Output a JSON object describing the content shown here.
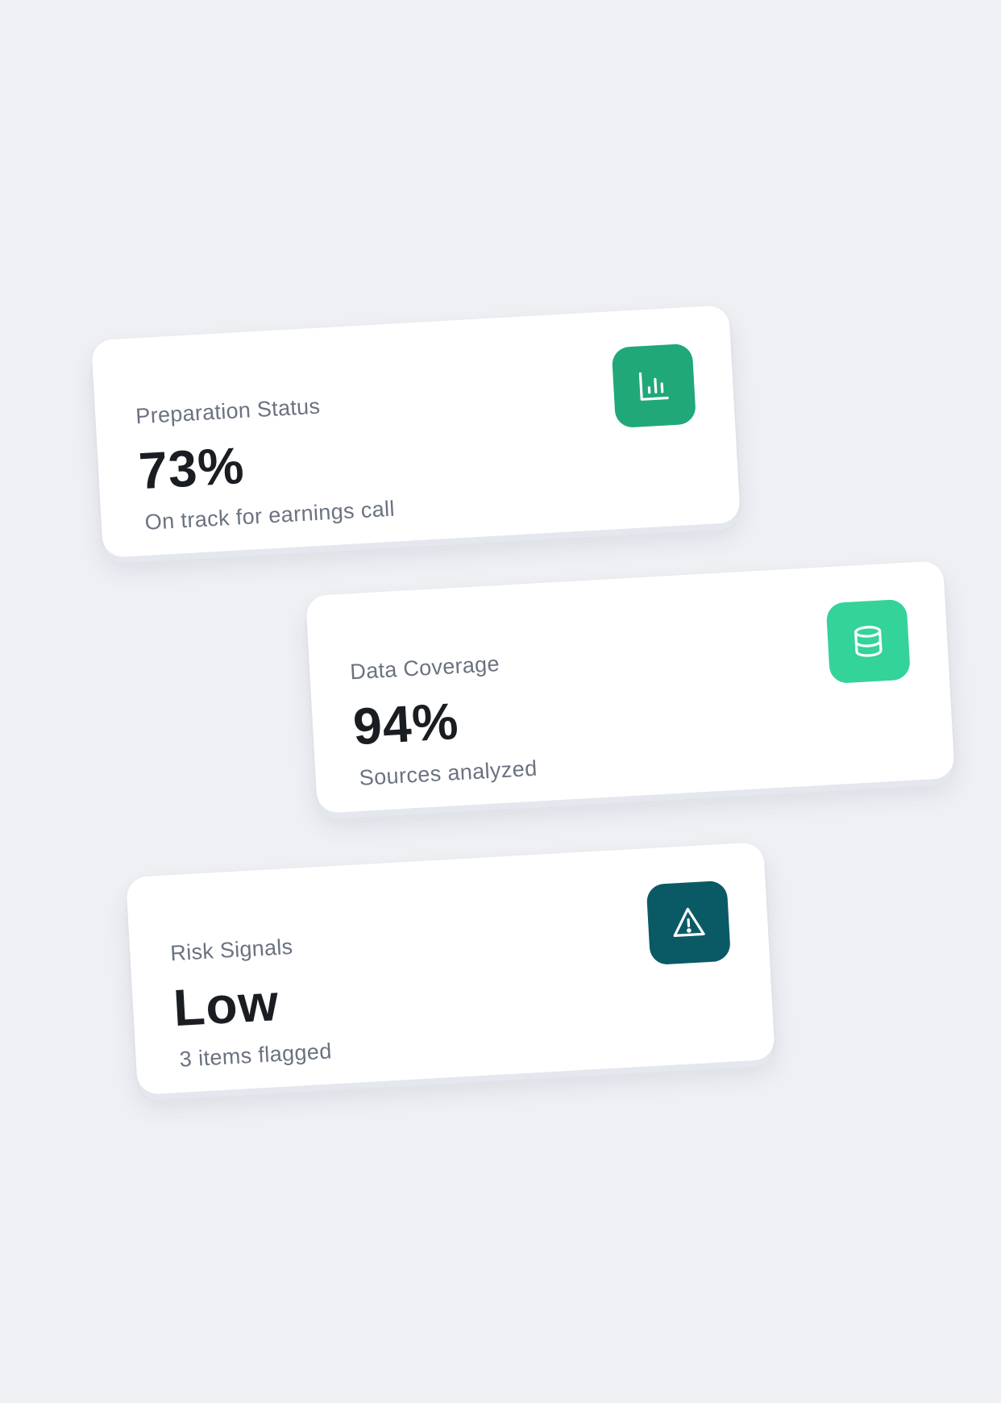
{
  "cards": [
    {
      "label": "Preparation Status",
      "value": "73%",
      "subtitle": "On track for earnings call",
      "icon": "bar-chart-icon",
      "icon_color": "#20a878"
    },
    {
      "label": "Data Coverage",
      "value": "94%",
      "subtitle": "Sources analyzed",
      "icon": "database-icon",
      "icon_color": "#34d399"
    },
    {
      "label": "Risk Signals",
      "value": "Low",
      "subtitle": "3 items flagged",
      "icon": "warning-triangle-icon",
      "icon_color": "#0a5a66"
    }
  ]
}
